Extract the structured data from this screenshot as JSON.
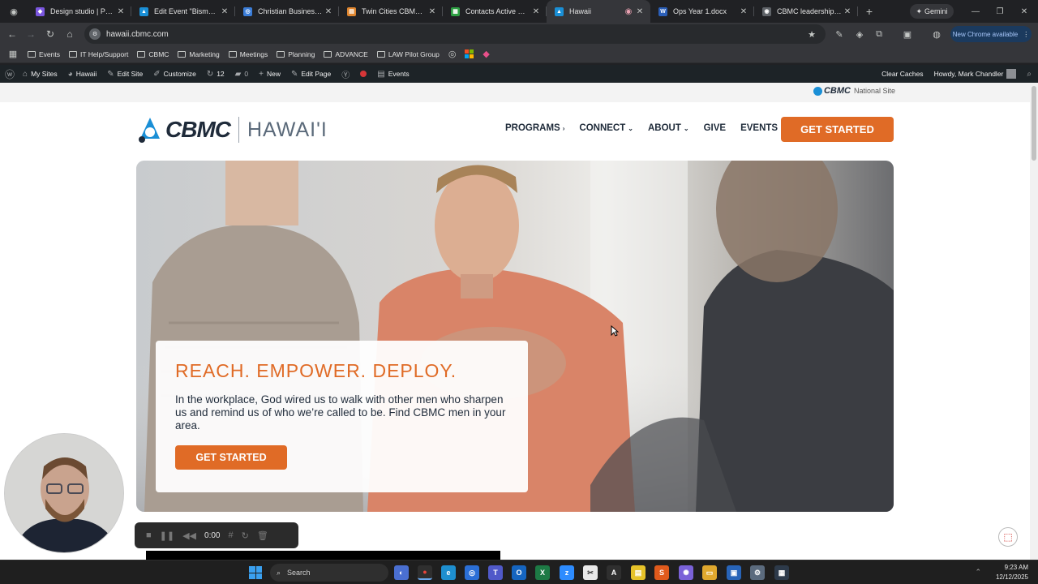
{
  "browser": {
    "tabs": [
      {
        "title": "Design studio | Power",
        "color": "#7b57e0",
        "glyph": "◆"
      },
      {
        "title": "Edit Event \"Bismarck C",
        "color": "#1a8fd6",
        "glyph": "▲"
      },
      {
        "title": "Christian Business Me",
        "color": "#3b7dd8",
        "glyph": "◎"
      },
      {
        "title": "Twin Cities CBMC Busi",
        "color": "#e0862f",
        "glyph": "▤"
      },
      {
        "title": "Contacts Active Conta",
        "color": "#2ea043",
        "glyph": "▦"
      },
      {
        "title": "Hawaii",
        "color": "#1a8fd6",
        "glyph": "▲"
      },
      {
        "title": "Ops Year 1.docx",
        "color": "#2b5fb8",
        "glyph": "W"
      },
      {
        "title": "CBMC leadership imp",
        "color": "#9aa0a6",
        "glyph": "◉"
      }
    ],
    "new_tab_glyph": "+",
    "gemini_label": "Gemini",
    "url": "hawaii.cbmc.com",
    "update_label": "New Chrome available"
  },
  "bookmarks": [
    {
      "label": "Events"
    },
    {
      "label": "IT Help/Support"
    },
    {
      "label": "CBMC"
    },
    {
      "label": "Marketing"
    },
    {
      "label": "Meetings"
    },
    {
      "label": "Planning"
    },
    {
      "label": "ADVANCE"
    },
    {
      "label": "LAW Pilot Group"
    }
  ],
  "wp_admin": {
    "my_sites": "My Sites",
    "site_name": "Hawaii",
    "edit_site": "Edit Site",
    "customize": "Customize",
    "updates_count": "12",
    "comments_count": "0",
    "new": "New",
    "edit_page": "Edit Page",
    "events": "Events",
    "clear_caches": "Clear Caches",
    "howdy": "Howdy, Mark Chandler"
  },
  "site": {
    "national_logo": "CBMC",
    "national_label": "National Site",
    "logo_word": "CBMC",
    "logo_region": "HAWAI'I",
    "nav": [
      {
        "label": "PROGRAMS",
        "caret": "›"
      },
      {
        "label": "CONNECT",
        "caret": "⌄"
      },
      {
        "label": "ABOUT",
        "caret": "⌄"
      },
      {
        "label": "GIVE",
        "caret": ""
      },
      {
        "label": "EVENTS",
        "caret": ""
      }
    ],
    "cta_top": "GET STARTED",
    "hero_heading": "REACH. EMPOWER. DEPLOY.",
    "hero_body": "In the workplace, God wired us to walk with other men who sharpen us and remind us of who we’re called to be. Find CBMC men in your area.",
    "hero_cta": "GET STARTED",
    "brand_orange": "#e06b26",
    "brand_navy": "#1f2b3a"
  },
  "recorder": {
    "time": "0:00"
  },
  "taskbar": {
    "search_placeholder": "Search",
    "time": "9:23 AM",
    "date": "12/12/2025"
  }
}
